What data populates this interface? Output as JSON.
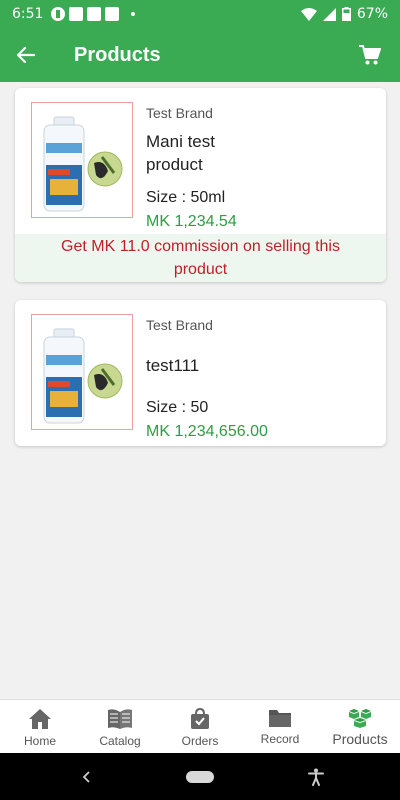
{
  "status_bar": {
    "time": "6:51",
    "battery": "67%"
  },
  "app_bar": {
    "title": "Products",
    "back_icon": "arrow-left-icon",
    "cart_icon": "cart-icon"
  },
  "products": [
    {
      "brand": "Test Brand",
      "name": "Mani test product",
      "size_label": "Size : 50ml",
      "price": "MK 1,234.54",
      "commission": "Get MK 11.0 commission on selling this product"
    },
    {
      "brand": "Test Brand",
      "name": "test111",
      "size_label": "Size : 50",
      "price": "MK 1,234,656.00"
    }
  ],
  "bottom_nav": {
    "items": [
      {
        "label": "Home",
        "icon": "home-icon"
      },
      {
        "label": "Catalog",
        "icon": "book-icon"
      },
      {
        "label": "Orders",
        "icon": "bag-icon"
      },
      {
        "label": "Record",
        "icon": "folder-icon"
      },
      {
        "label": "Products",
        "icon": "boxes-icon"
      }
    ],
    "active": "Products"
  },
  "colors": {
    "primary": "#3aaa53",
    "price": "#2e9d43",
    "commission_text": "#c0202a",
    "commission_bg": "#edf7ef"
  }
}
